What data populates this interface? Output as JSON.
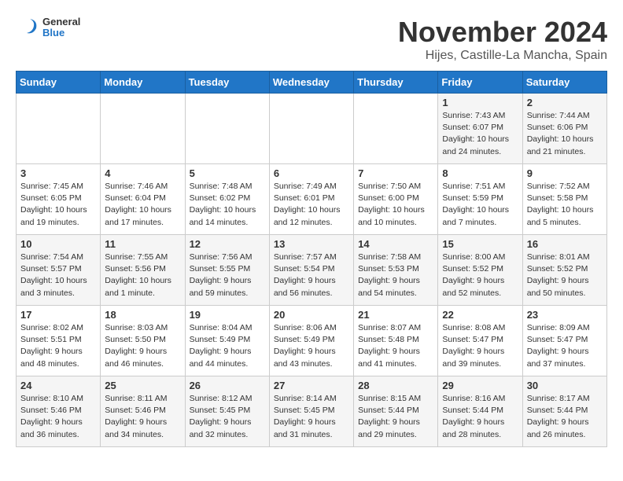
{
  "logo": {
    "general": "General",
    "blue": "Blue"
  },
  "header": {
    "month": "November 2024",
    "location": "Hijes, Castille-La Mancha, Spain"
  },
  "weekdays": [
    "Sunday",
    "Monday",
    "Tuesday",
    "Wednesday",
    "Thursday",
    "Friday",
    "Saturday"
  ],
  "weeks": [
    [
      {
        "day": "",
        "info": ""
      },
      {
        "day": "",
        "info": ""
      },
      {
        "day": "",
        "info": ""
      },
      {
        "day": "",
        "info": ""
      },
      {
        "day": "",
        "info": ""
      },
      {
        "day": "1",
        "info": "Sunrise: 7:43 AM\nSunset: 6:07 PM\nDaylight: 10 hours and 24 minutes."
      },
      {
        "day": "2",
        "info": "Sunrise: 7:44 AM\nSunset: 6:06 PM\nDaylight: 10 hours and 21 minutes."
      }
    ],
    [
      {
        "day": "3",
        "info": "Sunrise: 7:45 AM\nSunset: 6:05 PM\nDaylight: 10 hours and 19 minutes."
      },
      {
        "day": "4",
        "info": "Sunrise: 7:46 AM\nSunset: 6:04 PM\nDaylight: 10 hours and 17 minutes."
      },
      {
        "day": "5",
        "info": "Sunrise: 7:48 AM\nSunset: 6:02 PM\nDaylight: 10 hours and 14 minutes."
      },
      {
        "day": "6",
        "info": "Sunrise: 7:49 AM\nSunset: 6:01 PM\nDaylight: 10 hours and 12 minutes."
      },
      {
        "day": "7",
        "info": "Sunrise: 7:50 AM\nSunset: 6:00 PM\nDaylight: 10 hours and 10 minutes."
      },
      {
        "day": "8",
        "info": "Sunrise: 7:51 AM\nSunset: 5:59 PM\nDaylight: 10 hours and 7 minutes."
      },
      {
        "day": "9",
        "info": "Sunrise: 7:52 AM\nSunset: 5:58 PM\nDaylight: 10 hours and 5 minutes."
      }
    ],
    [
      {
        "day": "10",
        "info": "Sunrise: 7:54 AM\nSunset: 5:57 PM\nDaylight: 10 hours and 3 minutes."
      },
      {
        "day": "11",
        "info": "Sunrise: 7:55 AM\nSunset: 5:56 PM\nDaylight: 10 hours and 1 minute."
      },
      {
        "day": "12",
        "info": "Sunrise: 7:56 AM\nSunset: 5:55 PM\nDaylight: 9 hours and 59 minutes."
      },
      {
        "day": "13",
        "info": "Sunrise: 7:57 AM\nSunset: 5:54 PM\nDaylight: 9 hours and 56 minutes."
      },
      {
        "day": "14",
        "info": "Sunrise: 7:58 AM\nSunset: 5:53 PM\nDaylight: 9 hours and 54 minutes."
      },
      {
        "day": "15",
        "info": "Sunrise: 8:00 AM\nSunset: 5:52 PM\nDaylight: 9 hours and 52 minutes."
      },
      {
        "day": "16",
        "info": "Sunrise: 8:01 AM\nSunset: 5:52 PM\nDaylight: 9 hours and 50 minutes."
      }
    ],
    [
      {
        "day": "17",
        "info": "Sunrise: 8:02 AM\nSunset: 5:51 PM\nDaylight: 9 hours and 48 minutes."
      },
      {
        "day": "18",
        "info": "Sunrise: 8:03 AM\nSunset: 5:50 PM\nDaylight: 9 hours and 46 minutes."
      },
      {
        "day": "19",
        "info": "Sunrise: 8:04 AM\nSunset: 5:49 PM\nDaylight: 9 hours and 44 minutes."
      },
      {
        "day": "20",
        "info": "Sunrise: 8:06 AM\nSunset: 5:49 PM\nDaylight: 9 hours and 43 minutes."
      },
      {
        "day": "21",
        "info": "Sunrise: 8:07 AM\nSunset: 5:48 PM\nDaylight: 9 hours and 41 minutes."
      },
      {
        "day": "22",
        "info": "Sunrise: 8:08 AM\nSunset: 5:47 PM\nDaylight: 9 hours and 39 minutes."
      },
      {
        "day": "23",
        "info": "Sunrise: 8:09 AM\nSunset: 5:47 PM\nDaylight: 9 hours and 37 minutes."
      }
    ],
    [
      {
        "day": "24",
        "info": "Sunrise: 8:10 AM\nSunset: 5:46 PM\nDaylight: 9 hours and 36 minutes."
      },
      {
        "day": "25",
        "info": "Sunrise: 8:11 AM\nSunset: 5:46 PM\nDaylight: 9 hours and 34 minutes."
      },
      {
        "day": "26",
        "info": "Sunrise: 8:12 AM\nSunset: 5:45 PM\nDaylight: 9 hours and 32 minutes."
      },
      {
        "day": "27",
        "info": "Sunrise: 8:14 AM\nSunset: 5:45 PM\nDaylight: 9 hours and 31 minutes."
      },
      {
        "day": "28",
        "info": "Sunrise: 8:15 AM\nSunset: 5:44 PM\nDaylight: 9 hours and 29 minutes."
      },
      {
        "day": "29",
        "info": "Sunrise: 8:16 AM\nSunset: 5:44 PM\nDaylight: 9 hours and 28 minutes."
      },
      {
        "day": "30",
        "info": "Sunrise: 8:17 AM\nSunset: 5:44 PM\nDaylight: 9 hours and 26 minutes."
      }
    ]
  ]
}
